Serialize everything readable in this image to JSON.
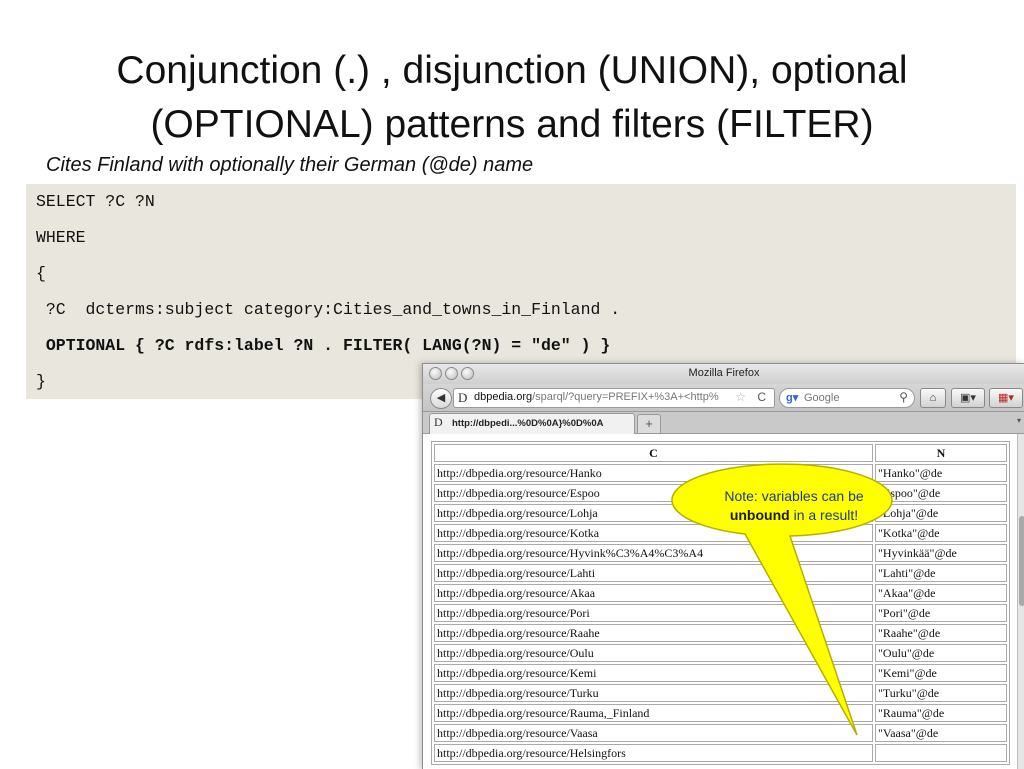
{
  "slide": {
    "title_line1": "Conjunction (.) , disjunction (UNION), optional",
    "title_line2": "(OPTIONAL) patterns and filters (FILTER)",
    "subtitle": "Cites Finland with optionally their German (@de) name"
  },
  "code": {
    "lines": [
      "SELECT ?C ?N",
      "WHERE",
      "{",
      " ?C  dcterms:subject category:Cities_and_towns_in_Finland .",
      " OPTIONAL { ?C rdfs:label ?N . FILTER( LANG(?N) = \"de\" ) }",
      "}"
    ]
  },
  "browser": {
    "window_title": "Mozilla Firefox",
    "url_host": "dbpedia.org",
    "url_path": "/sparql/?query=PREFIX+%3A+<http%",
    "search_placeholder": "Google",
    "tab_label": "http://dbpedi...%0D%0A}%0D%0A",
    "back_icon": "back-arrow-icon",
    "new_tab_label": "+"
  },
  "results": {
    "headers": [
      "C",
      "N"
    ],
    "rows": [
      [
        "http://dbpedia.org/resource/Hanko",
        "\"Hanko\"@de"
      ],
      [
        "http://dbpedia.org/resource/Espoo",
        "\"Espoo\"@de"
      ],
      [
        "http://dbpedia.org/resource/Lohja",
        "\"Lohja\"@de"
      ],
      [
        "http://dbpedia.org/resource/Kotka",
        "\"Kotka\"@de"
      ],
      [
        "http://dbpedia.org/resource/Hyvink%C3%A4%C3%A4",
        "\"Hyvinkää\"@de"
      ],
      [
        "http://dbpedia.org/resource/Lahti",
        "\"Lahti\"@de"
      ],
      [
        "http://dbpedia.org/resource/Akaa",
        "\"Akaa\"@de"
      ],
      [
        "http://dbpedia.org/resource/Pori",
        "\"Pori\"@de"
      ],
      [
        "http://dbpedia.org/resource/Raahe",
        "\"Raahe\"@de"
      ],
      [
        "http://dbpedia.org/resource/Oulu",
        "\"Oulu\"@de"
      ],
      [
        "http://dbpedia.org/resource/Kemi",
        "\"Kemi\"@de"
      ],
      [
        "http://dbpedia.org/resource/Turku",
        "\"Turku\"@de"
      ],
      [
        "http://dbpedia.org/resource/Rauma,_Finland",
        "\"Rauma\"@de"
      ],
      [
        "http://dbpedia.org/resource/Vaasa",
        "\"Vaasa\"@de"
      ],
      [
        "http://dbpedia.org/resource/Helsingfors",
        ""
      ]
    ]
  },
  "callout": {
    "text_before": "Note: variables can be",
    "text_bold": "unbound",
    "text_after": "in a result!",
    "fill_color": "#ffff00",
    "stroke_color": "#b5b000"
  }
}
